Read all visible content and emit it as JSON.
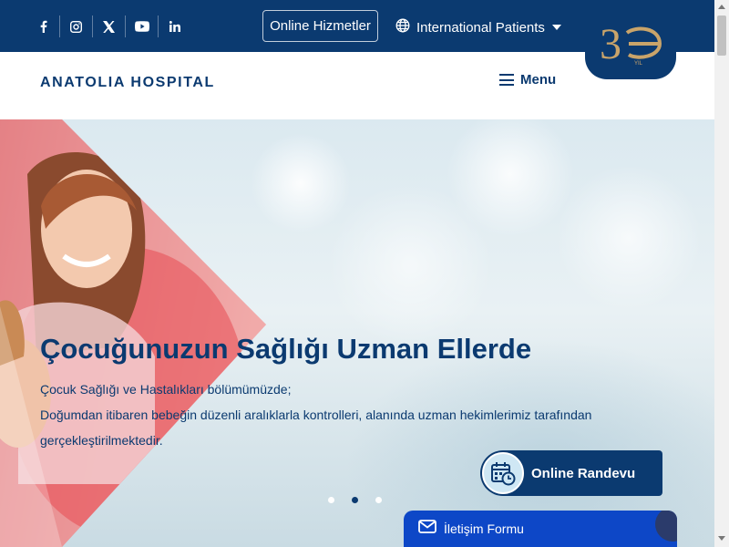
{
  "topbar": {
    "social": [
      {
        "icon": "facebook-icon"
      },
      {
        "icon": "instagram-icon"
      },
      {
        "icon": "x-icon"
      },
      {
        "icon": "youtube-icon"
      },
      {
        "icon": "linkedin-icon"
      }
    ],
    "online_services_label": "Online Hizmetler",
    "international_label": "International Patients",
    "badge": {
      "number": "3",
      "sub": "YIL"
    }
  },
  "header": {
    "logo": "ANATOLIA HOSPITAL",
    "menu_label": "Menu"
  },
  "hero": {
    "title": "Çocuğunuzun Sağlığı Uzman Ellerde",
    "line1": "Çocuk Sağlığı ve Hastalıkları bölümümüzde;",
    "line2": "Doğumdan itibaren bebeğin düzenli aralıklarla kontrolleri, alanında uzman hekimlerimiz tarafından gerçekleştirilmektedir.",
    "slides": 3,
    "active_slide": 2
  },
  "floating": {
    "appointment_label": "Online Randevu",
    "contact_label": "İletişim Formu"
  },
  "colors": {
    "primary": "#0b3a70",
    "contact_blue": "#0d47c7",
    "accent_red": "#e8474f"
  }
}
